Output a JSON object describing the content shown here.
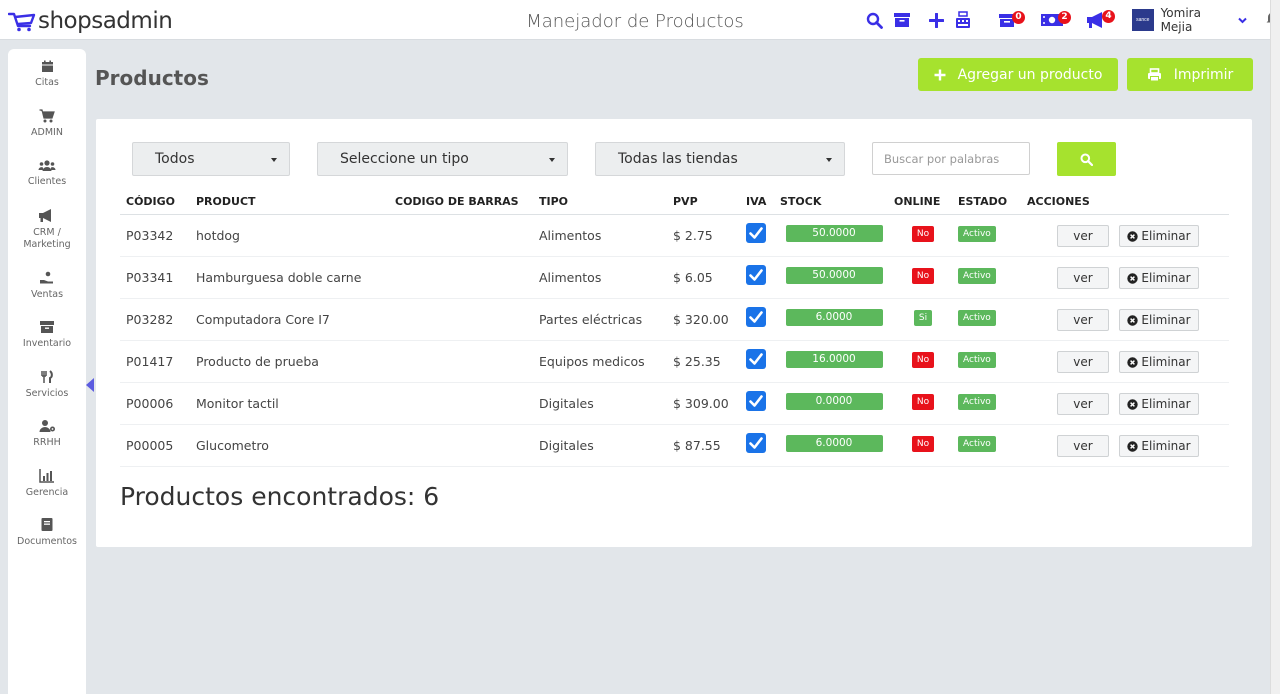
{
  "app": {
    "logo_text": "shopsadmin",
    "title": "Manejador de Productos",
    "user_name": "Yomira Mejia",
    "avatar_text": "sance",
    "badges": {
      "alerts": "0",
      "tickets": "2",
      "megaphone": "4"
    }
  },
  "sidebar": {
    "items": [
      {
        "label": "Citas",
        "icon": "calendar-icon"
      },
      {
        "label": "ADMIN",
        "icon": "cart-icon"
      },
      {
        "label": "Clientes",
        "icon": "users-icon"
      },
      {
        "label": "CRM / Marketing",
        "icon": "megaphone-icon"
      },
      {
        "label": "Ventas",
        "icon": "hand-money-icon"
      },
      {
        "label": "Inventario",
        "icon": "archive-icon"
      },
      {
        "label": "Servicios",
        "icon": "utensils-icon"
      },
      {
        "label": "RRHH",
        "icon": "user-gear-icon"
      },
      {
        "label": "Gerencia",
        "icon": "chart-icon"
      },
      {
        "label": "Documentos",
        "icon": "book-icon"
      }
    ],
    "active": "Inventario"
  },
  "page": {
    "title": "Productos",
    "add_label": "Agregar un producto",
    "print_label": "Imprimir"
  },
  "filters": {
    "category": "Todos",
    "type": "Seleccione un tipo",
    "store": "Todas las tiendas",
    "search_placeholder": "Buscar por palabras"
  },
  "table": {
    "headers": {
      "code": "CÓDIGO",
      "product": "PRODUCT",
      "barcode": "CODIGO DE BARRAS",
      "type": "TIPO",
      "price": "PVP",
      "iva": "IVA",
      "stock": "STOCK",
      "online": "ONLINE",
      "status": "ESTADO",
      "actions": "ACCIONES"
    },
    "view_label": "ver",
    "delete_label": "Eliminar",
    "rows": [
      {
        "code": "P03342",
        "product": "hotdog",
        "barcode": "",
        "type": "Alimentos",
        "price": "$ 2.75",
        "iva": true,
        "stock": "50.0000",
        "online": "No",
        "status": "Activo"
      },
      {
        "code": "P03341",
        "product": "Hamburguesa doble carne",
        "barcode": "",
        "type": "Alimentos",
        "price": "$ 6.05",
        "iva": true,
        "stock": "50.0000",
        "online": "No",
        "status": "Activo"
      },
      {
        "code": "P03282",
        "product": "Computadora Core I7",
        "barcode": "",
        "type": "Partes eléctricas",
        "price": "$ 320.00",
        "iva": true,
        "stock": "6.0000",
        "online": "Si",
        "status": "Activo"
      },
      {
        "code": "P01417",
        "product": "Producto de prueba",
        "barcode": "",
        "type": "Equipos medicos",
        "price": "$ 25.35",
        "iva": true,
        "stock": "16.0000",
        "online": "No",
        "status": "Activo"
      },
      {
        "code": "P00006",
        "product": "Monitor tactil",
        "barcode": "",
        "type": "Digitales",
        "price": "$ 309.00",
        "iva": true,
        "stock": "0.0000",
        "online": "No",
        "status": "Activo"
      },
      {
        "code": "P00005",
        "product": "Glucometro",
        "barcode": "",
        "type": "Digitales",
        "price": "$ 87.55",
        "iva": true,
        "stock": "6.0000",
        "online": "No",
        "status": "Activo"
      }
    ]
  },
  "summary": {
    "found_label": "Productos encontrados: 6"
  },
  "colors": {
    "accent_green": "#a6e22e",
    "stock_green": "#5cb85c",
    "danger_red": "#e8121b",
    "icon_blue": "#3a2fe6",
    "active_arrow": "#5c5ce0"
  }
}
